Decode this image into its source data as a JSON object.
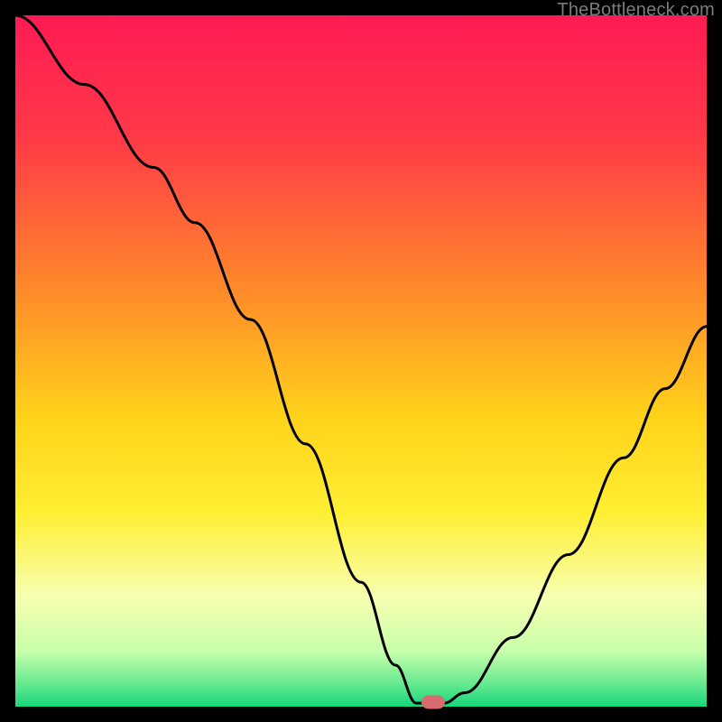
{
  "watermark": "TheBottleneck.com",
  "chart_data": {
    "type": "line",
    "title": "",
    "xlabel": "",
    "ylabel": "",
    "xlim": [
      0,
      100
    ],
    "ylim": [
      0,
      100
    ],
    "grid": false,
    "legend": false,
    "gradient_stops": [
      {
        "pos": 0,
        "color": "#ff1a54"
      },
      {
        "pos": 18,
        "color": "#ff3a47"
      },
      {
        "pos": 40,
        "color": "#ff8b2a"
      },
      {
        "pos": 58,
        "color": "#ffd21a"
      },
      {
        "pos": 72,
        "color": "#ffef33"
      },
      {
        "pos": 84,
        "color": "#f8ffb0"
      },
      {
        "pos": 92,
        "color": "#c7ffab"
      },
      {
        "pos": 97,
        "color": "#5fe88e"
      },
      {
        "pos": 100,
        "color": "#16d67a"
      }
    ],
    "series": [
      {
        "name": "bottleneck-curve",
        "color": "#000000",
        "width": 3,
        "points": [
          {
            "x": 0,
            "y": 100
          },
          {
            "x": 10,
            "y": 90
          },
          {
            "x": 20,
            "y": 78
          },
          {
            "x": 26,
            "y": 70
          },
          {
            "x": 34,
            "y": 56
          },
          {
            "x": 42,
            "y": 38
          },
          {
            "x": 50,
            "y": 18
          },
          {
            "x": 55,
            "y": 6
          },
          {
            "x": 58,
            "y": 0.5
          },
          {
            "x": 62,
            "y": 0.5
          },
          {
            "x": 65,
            "y": 2
          },
          {
            "x": 72,
            "y": 10
          },
          {
            "x": 80,
            "y": 22
          },
          {
            "x": 88,
            "y": 36
          },
          {
            "x": 94,
            "y": 46
          },
          {
            "x": 100,
            "y": 55
          }
        ]
      }
    ],
    "marker": {
      "x": 60.5,
      "y": 0.7,
      "color": "#d86b70"
    }
  }
}
